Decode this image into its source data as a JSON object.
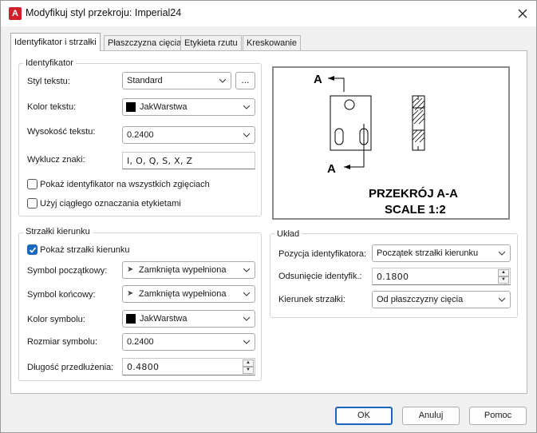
{
  "window": {
    "title": "Modyfikuj styl przekroju: Imperial24",
    "app_icon_letter": "A"
  },
  "tabs": [
    {
      "label": "Identyfikator i strzałki",
      "active": true
    },
    {
      "label": "Płaszczyzna cięcia",
      "active": false
    },
    {
      "label": "Etykieta rzutu",
      "active": false
    },
    {
      "label": "Kreskowanie",
      "active": false
    }
  ],
  "identifier": {
    "title": "Identyfikator",
    "text_style_label": "Styl tekstu:",
    "text_style_value": "Standard",
    "ellipsis_label": "...",
    "text_color_label": "Kolor tekstu:",
    "text_color_value": "JakWarstwa",
    "text_height_label": "Wysokość tekstu:",
    "text_height_value": "0.2400",
    "exclude_label": "Wyklucz znaki:",
    "exclude_value": "I, O, Q, S, X, Z",
    "show_all_bends_label": "Pokaż identyfikator na wszystkich zgięciach",
    "show_all_bends_checked": false,
    "continuous_label": "Użyj ciągłego oznaczania etykietami",
    "continuous_checked": false
  },
  "arrows": {
    "title": "Strzałki kierunku",
    "show_arrows_label": "Pokaż strzałki kierunku",
    "show_arrows_checked": true,
    "start_symbol_label": "Symbol początkowy:",
    "start_symbol_value": "Zamknięta wypełniona",
    "end_symbol_label": "Symbol końcowy:",
    "end_symbol_value": "Zamknięta wypełniona",
    "symbol_color_label": "Kolor symbolu:",
    "symbol_color_value": "JakWarstwa",
    "symbol_size_label": "Rozmiar symbolu:",
    "symbol_size_value": "0.2400",
    "extension_label": "Długość przedłużenia:",
    "extension_value": "0.4800"
  },
  "layout": {
    "title": "Układ",
    "id_position_label": "Pozycja identyfikatora:",
    "id_position_value": "Początek strzałki kierunku",
    "id_offset_label": "Odsunięcie identyfik.:",
    "id_offset_value": "0.1800",
    "arrow_direction_label": "Kierunek strzałki:",
    "arrow_direction_value": "Od płaszczyzny cięcia"
  },
  "preview": {
    "marker_top": "A",
    "marker_bottom": "A",
    "section_title": "PRZEKRÓJ A-A",
    "scale_text": "SCALE 1:2"
  },
  "buttons": {
    "ok": "OK",
    "cancel": "Anuluj",
    "help": "Pomoc"
  },
  "colors": {
    "accent": "#1a66c0",
    "swatch": "#000000"
  }
}
